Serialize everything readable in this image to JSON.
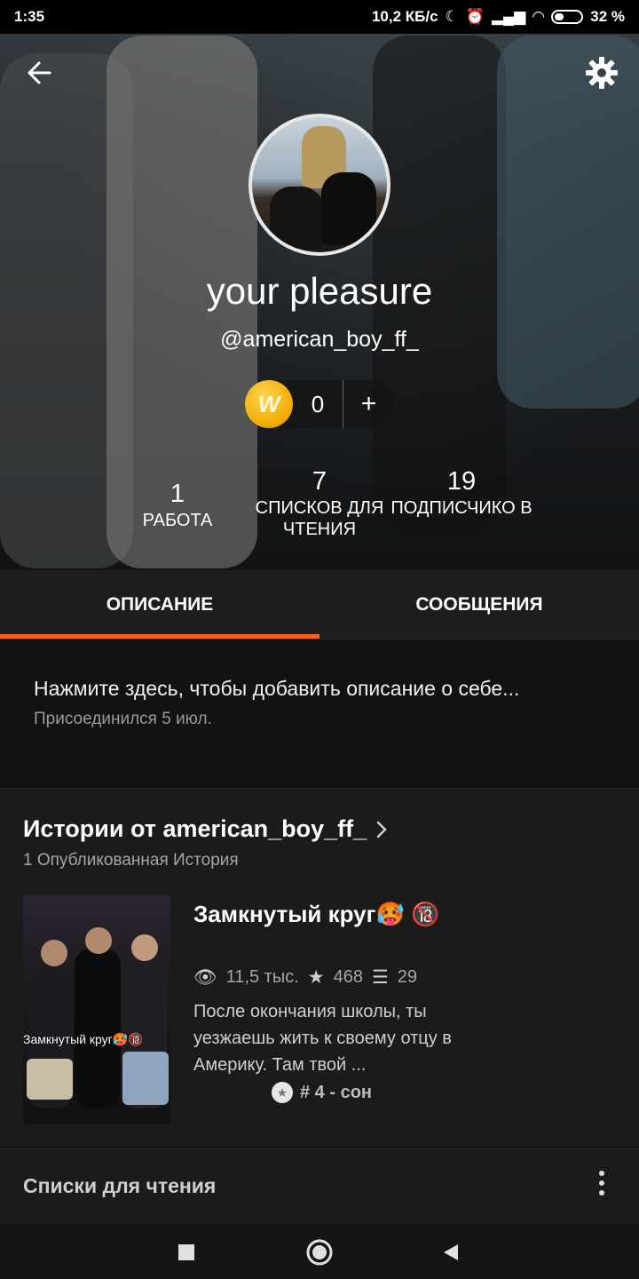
{
  "status_bar": {
    "time": "1:35",
    "network_speed": "10,2 КБ/с",
    "battery": "32 %"
  },
  "profile": {
    "display_name": "your pleasure",
    "username": "@american_boy_ff_",
    "coins": "0",
    "coin_add": "+",
    "stats": [
      {
        "value": "1",
        "label": "РАБОТА"
      },
      {
        "value": "7",
        "label": "СПИСКОВ ДЛЯ ЧТЕНИЯ"
      },
      {
        "value": "19",
        "label": "ПОДПИСЧИКО В"
      }
    ]
  },
  "tabs": [
    {
      "label": "ОПИСАНИЕ",
      "active": true
    },
    {
      "label": "СООБЩЕНИЯ",
      "active": false
    }
  ],
  "description": {
    "prompt": "Нажмите здесь, чтобы добавить описание о себе...",
    "joined": "Присоединился 5 июл."
  },
  "stories": {
    "heading": "Истории от american_boy_ff_",
    "count_label": "1 Опубликованная История",
    "items": [
      {
        "title": "Замкнутый круг🥵 🔞",
        "cover_text": "Замкнутый круг🥵🔞",
        "reads": "11,5 тыс.",
        "votes": "468",
        "parts": "29",
        "description": "После окончания школы, ты уезжаешь жить к своему отцу в Америку. Там твой ...",
        "rank": "# 4 - сон"
      }
    ]
  },
  "reading_lists": {
    "label": "Списки для чтения"
  },
  "colors": {
    "accent": "#ff6122",
    "background": "#121212",
    "card": "#1b1b1b"
  }
}
